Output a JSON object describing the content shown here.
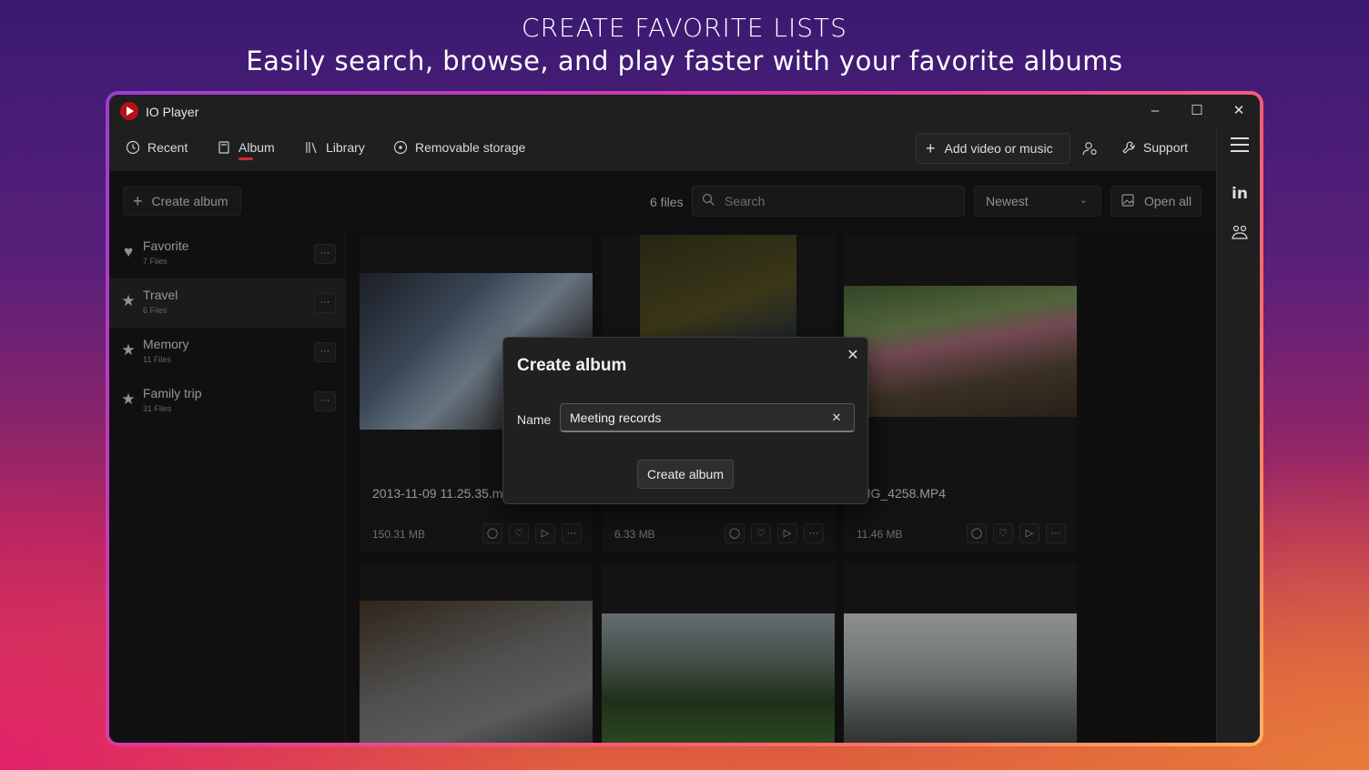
{
  "promo": {
    "title": "CREATE FAVORITE LISTS",
    "subtitle": "Easily search, browse, and play faster with your favorite albums"
  },
  "window": {
    "app_title": "IO Player",
    "controls": {
      "minimize": "–",
      "maximize": "☐",
      "close": "✕"
    }
  },
  "nav": {
    "items": [
      {
        "label": "Recent",
        "icon": "clock-icon"
      },
      {
        "label": "Album",
        "icon": "album-icon",
        "active": true
      },
      {
        "label": "Library",
        "icon": "library-icon"
      },
      {
        "label": "Removable storage",
        "icon": "disc-icon"
      }
    ],
    "add_label": "Add video or music",
    "support_label": "Support"
  },
  "rail": {
    "linkedin": "in"
  },
  "toolbar": {
    "create_label": "Create album",
    "file_count": "6 files",
    "search_placeholder": "Search",
    "sort_value": "Newest",
    "open_all_label": "Open all"
  },
  "albums": [
    {
      "name": "Favorite",
      "count": "7 Files",
      "icon": "heart-icon"
    },
    {
      "name": "Travel",
      "count": "6 Files",
      "icon": "star-icon",
      "active": true
    },
    {
      "name": "Memory",
      "count": "11 Files",
      "icon": "star-icon"
    },
    {
      "name": "Family trip",
      "count": "31 Files",
      "icon": "star-icon"
    }
  ],
  "files": [
    {
      "name": "2013-11-09 11.25.35.mp4",
      "size": "150.31 MB"
    },
    {
      "name": "",
      "size": "6.33 MB"
    },
    {
      "name": "IMG_4258.MP4",
      "size": "11.46 MB"
    }
  ],
  "dialog": {
    "title": "Create album",
    "name_label": "Name",
    "name_value": "Meeting records",
    "create_label": "Create album"
  },
  "colors": {
    "accent": "#d42a2a",
    "brand": "#b5121b",
    "frame_start": "#9b3dd8",
    "frame_end": "#ffb060"
  }
}
